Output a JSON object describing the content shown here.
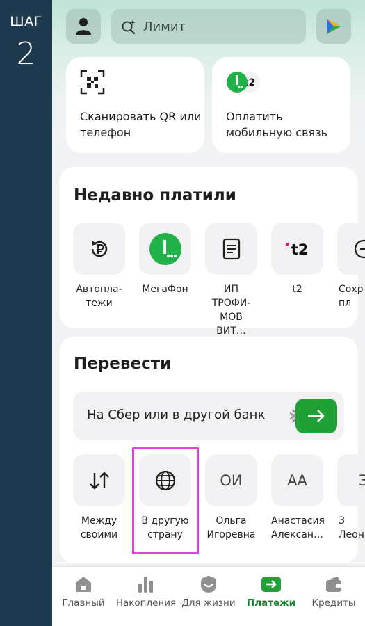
{
  "step": {
    "label": "ШАГ",
    "number": "2"
  },
  "search": {
    "placeholder": "Лимит"
  },
  "quick_actions": [
    {
      "label": "Сканировать QR или телефон",
      "icon": "qr-scan-icon"
    },
    {
      "label": "Оплатить мобильную связь",
      "icon": "mobile-operators-icon"
    }
  ],
  "recent": {
    "title": "Недавно платили",
    "items": [
      {
        "label": "Автопла-\nтежи",
        "icon": "autopay-ruble-icon"
      },
      {
        "label": "МегаФон",
        "icon": "megafon-icon"
      },
      {
        "label": "ИП ТРОФИ-\nМОВ ВИТ…",
        "icon": "document-icon"
      },
      {
        "label": "t2",
        "icon": "t2-logo-icon"
      },
      {
        "label": "Сохр\nпл",
        "icon": "saved-icon"
      }
    ]
  },
  "transfer": {
    "title": "Перевести",
    "bar_text": "На Сбер или в другой банк",
    "items": [
      {
        "label": "Между\nсвоими",
        "icon": "transfer-arrows-icon",
        "text": ""
      },
      {
        "label": "В другую\nстрану",
        "icon": "globe-icon",
        "text": ""
      },
      {
        "label": "Ольга\nИгоревна",
        "icon": "",
        "text": "ОИ"
      },
      {
        "label": "Анастасия\nАлексан…",
        "icon": "",
        "text": "АА"
      },
      {
        "label": "З\nЛеон",
        "icon": "",
        "text": "З"
      }
    ]
  },
  "tabs": [
    {
      "label": "Главный",
      "icon": "home-icon",
      "active": false
    },
    {
      "label": "Накопления",
      "icon": "savings-chart-icon",
      "active": false
    },
    {
      "label": "Для жизни",
      "icon": "lifestyle-icon",
      "active": false
    },
    {
      "label": "Платежи",
      "icon": "payments-icon",
      "active": true
    },
    {
      "label": "Кредиты",
      "icon": "credits-wallet-icon",
      "active": false
    }
  ],
  "colors": {
    "accent": "#21a038",
    "strip": "#1e3a4f",
    "highlight": "#e040e0"
  }
}
